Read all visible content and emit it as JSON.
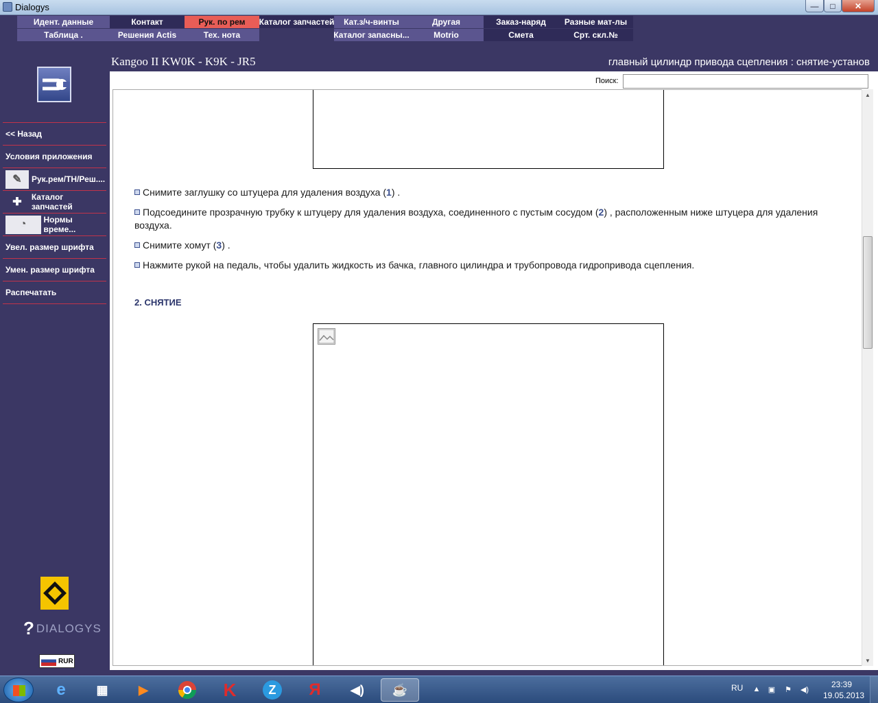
{
  "window": {
    "title": "Dialogys",
    "min": "—",
    "max": "□",
    "close": "✕"
  },
  "topnav": {
    "row1": [
      "Идент. данные",
      "Контакт",
      "Рук. по рем",
      "Каталог запчастей",
      "Кат.з/ч-винты",
      "Другая",
      "Заказ-наряд",
      "Разные мат-лы"
    ],
    "row2": [
      "Таблица .",
      "Решения Actis",
      "Тех. нота",
      "",
      "Каталог запасны...",
      "Motrio",
      "Смета",
      "Срт. скл.№"
    ]
  },
  "sidebar": {
    "items": [
      {
        "label": "<< Назад"
      },
      {
        "label": "Условия приложения"
      },
      {
        "label": "Рук.рем/ТН/Реш...."
      },
      {
        "label": "Каталог запчастей"
      },
      {
        "label": "Нормы време..."
      },
      {
        "label": "Увел. размер шрифта"
      },
      {
        "label": "Умен. размер шрифта"
      },
      {
        "label": "Распечатать"
      }
    ],
    "brand": "DIALOGYS",
    "brand_mark": "?",
    "currency": "RUR"
  },
  "header": {
    "vehicle": "Kangoo II KW0K - K9K - JR5",
    "procedure": "главный цилиндр привода сцепления : снятие-установ"
  },
  "search": {
    "label": "Поиск:",
    "value": ""
  },
  "document": {
    "steps": [
      {
        "before": "Снимите заглушку со штуцера для удаления воздуха (",
        "ref": "1",
        "after": ") ."
      },
      {
        "before": "Подсоедините прозрачную трубку к штуцеру для удаления воздуха, соединенного с пустым сосудом (",
        "ref": "2",
        "after": ") , расположенным ниже штуцера для удаления воздуха."
      },
      {
        "before": "Снимите хомут (",
        "ref": "3",
        "after": ") ."
      },
      {
        "before": "Нажмите рукой на педаль, чтобы удалить жидкость из бачка, главного цилиндра и трубопровода гидропривода сцепления.",
        "ref": "",
        "after": ""
      }
    ],
    "section_heading": "2. СНЯТИЕ"
  },
  "taskbar": {
    "lang": "RU",
    "time": "23:39",
    "date": "19.05.2013",
    "apps": [
      "ie-icon",
      "explorer-icon",
      "media-player-icon",
      "chrome-icon",
      "kaspersky-icon",
      "z-app-icon",
      "yandex-icon",
      "audio-icon",
      "java-icon"
    ]
  },
  "colors": {
    "accent_red": "#e85d57",
    "nav_purple": "#5b558f",
    "nav_dark": "#2f2b58",
    "sidebar": "#3b3764",
    "divider": "#c3334a"
  }
}
